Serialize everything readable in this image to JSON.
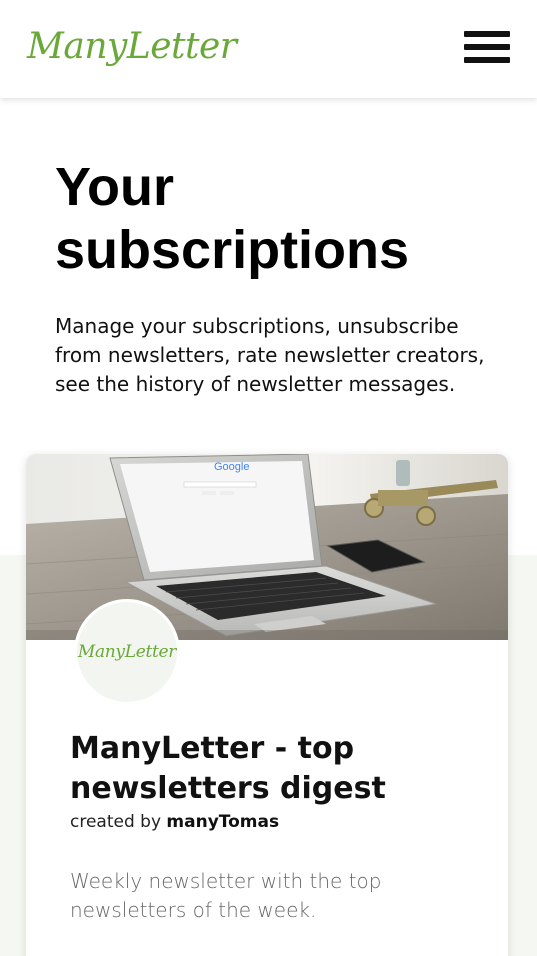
{
  "header": {
    "logo_text": "ManyLetter"
  },
  "hero": {
    "title": "Your subscriptions",
    "description": "Manage your subscriptions, unsubscribe from newsletters, rate newsletter creators, see the history of newsletter messages."
  },
  "card": {
    "avatar_text": "ManyLetter",
    "title": "ManyLetter - top newsletters digest",
    "author_prefix": "created by",
    "author_name": "manyTomas",
    "description": "Weekly newsletter with the top newsletters of the week.",
    "image_screen_text": "Google"
  },
  "colors": {
    "brand_green": "#6aa83a",
    "band_background": "#f5f7f2"
  }
}
